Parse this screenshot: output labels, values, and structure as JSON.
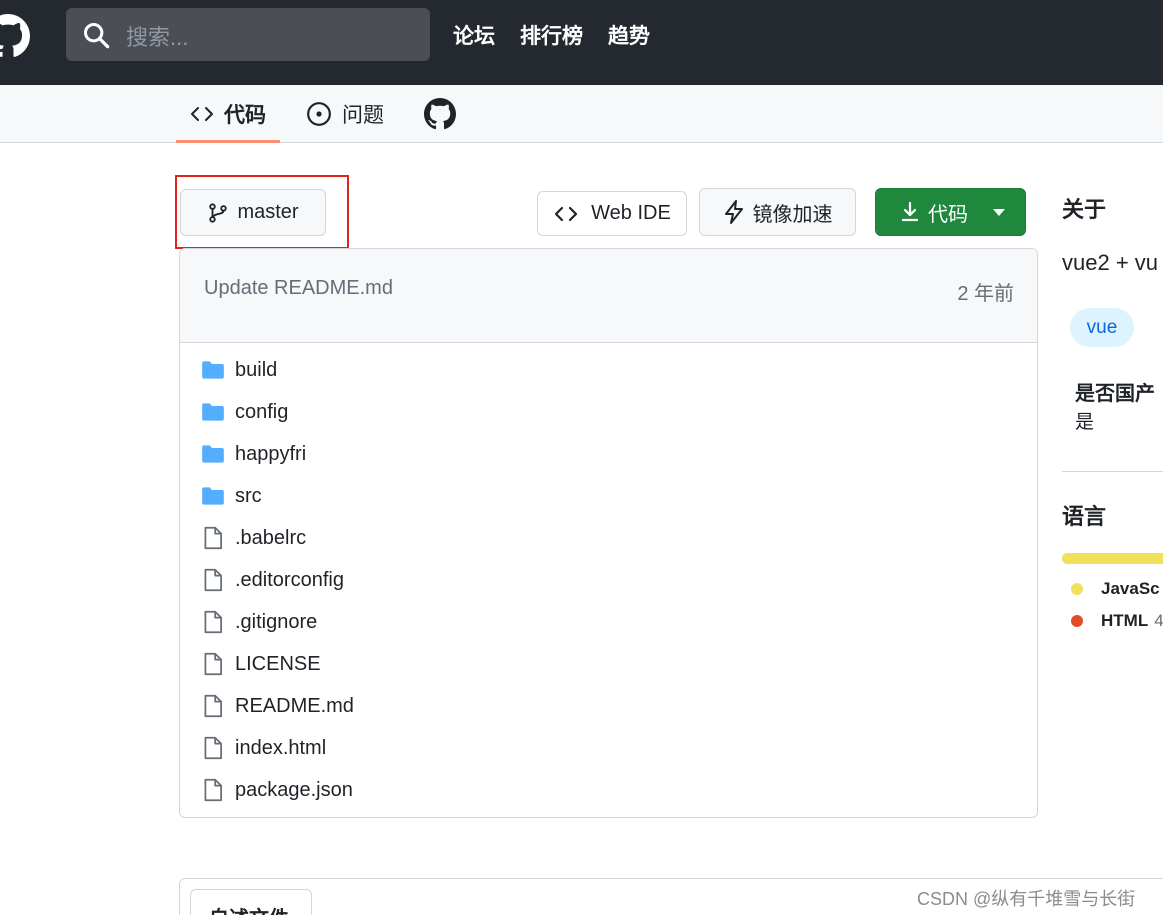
{
  "header": {
    "search_placeholder": "搜索...",
    "nav": [
      "论坛",
      "排行榜",
      "趋势"
    ]
  },
  "tabs": {
    "code": "代码",
    "issues": "问题"
  },
  "toolbar": {
    "branch": "master",
    "web_ide": "Web IDE",
    "mirror": "镜像加速",
    "code": "代码"
  },
  "commit": {
    "message": "Update README.md",
    "time": "2 年前"
  },
  "files": [
    {
      "name": "build",
      "type": "folder"
    },
    {
      "name": "config",
      "type": "folder"
    },
    {
      "name": "happyfri",
      "type": "folder"
    },
    {
      "name": "src",
      "type": "folder"
    },
    {
      "name": ".babelrc",
      "type": "file"
    },
    {
      "name": ".editorconfig",
      "type": "file"
    },
    {
      "name": ".gitignore",
      "type": "file"
    },
    {
      "name": "LICENSE",
      "type": "file"
    },
    {
      "name": "README.md",
      "type": "file"
    },
    {
      "name": "index.html",
      "type": "file"
    },
    {
      "name": "package.json",
      "type": "file"
    }
  ],
  "sidebar": {
    "about_title": "关于",
    "description": "vue2 + vu",
    "topic": "vue",
    "domestic_label": "是否国产",
    "domestic_value": "是",
    "languages_title": "语言",
    "languages": [
      {
        "name": "JavaSc",
        "pct": "",
        "color": "#f1e05a"
      },
      {
        "name": "HTML",
        "pct": "4",
        "color": "#e34c26"
      }
    ]
  },
  "readme": {
    "tab_label": "自述文件"
  },
  "watermark": "CSDN @纵有千堆雪与长街"
}
